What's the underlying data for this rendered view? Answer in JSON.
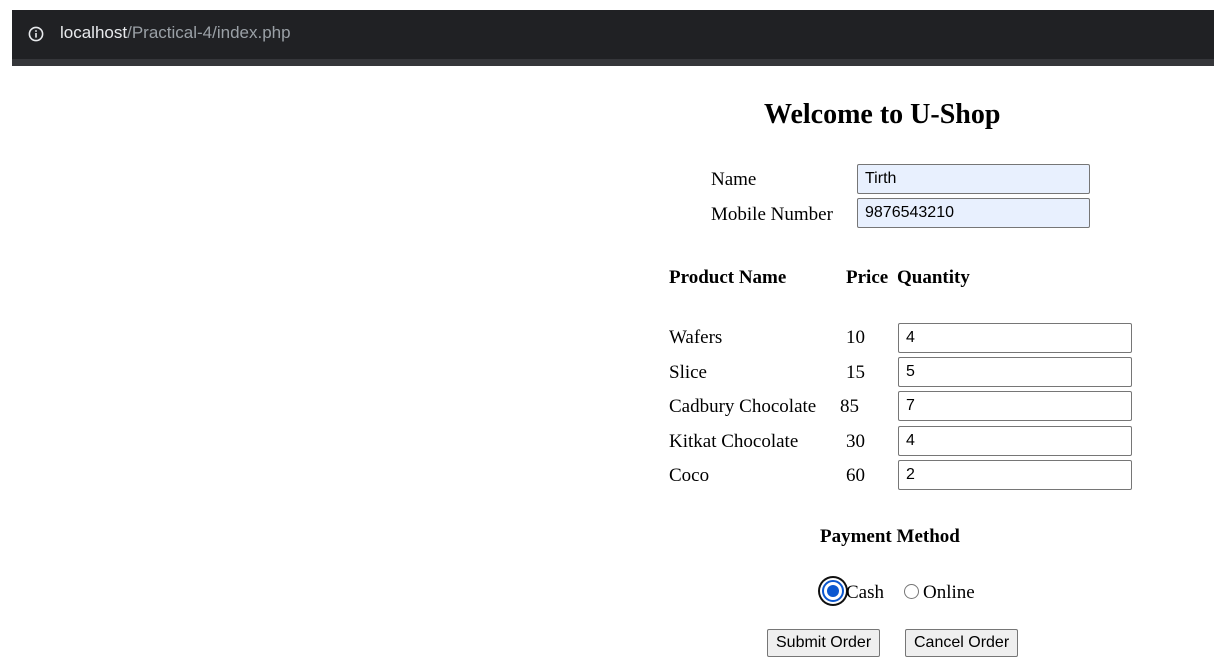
{
  "browser": {
    "url_host": "localhost",
    "url_path": "/Practical-4/index.php",
    "info_icon": "info-circle-icon"
  },
  "page": {
    "title": "Welcome to U-Shop"
  },
  "customer": {
    "name_label": "Name",
    "name_value": "Tirth",
    "mobile_label": "Mobile Number",
    "mobile_value": "9876543210"
  },
  "products": {
    "headers": [
      "Product Name",
      "Price",
      "Quantity"
    ],
    "rows": [
      {
        "name": "Wafers",
        "price": "10",
        "quantity": "4"
      },
      {
        "name": "Slice",
        "price": "15",
        "quantity": "5"
      },
      {
        "name": "Cadbury Chocolate",
        "price": "85",
        "quantity": "7"
      },
      {
        "name": "Kitkat Chocolate",
        "price": "30",
        "quantity": "4"
      },
      {
        "name": "Coco",
        "price": "60",
        "quantity": "2"
      }
    ]
  },
  "payment": {
    "heading": "Payment Method",
    "options": [
      {
        "label": "Cash",
        "checked": true
      },
      {
        "label": "Online",
        "checked": false
      }
    ]
  },
  "actions": {
    "submit_label": "Submit Order",
    "cancel_label": "Cancel Order"
  },
  "colors": {
    "address_bar_bg": "#202124",
    "autofill_bg": "#e8f0fe",
    "radio_accent": "#0b57d0"
  }
}
